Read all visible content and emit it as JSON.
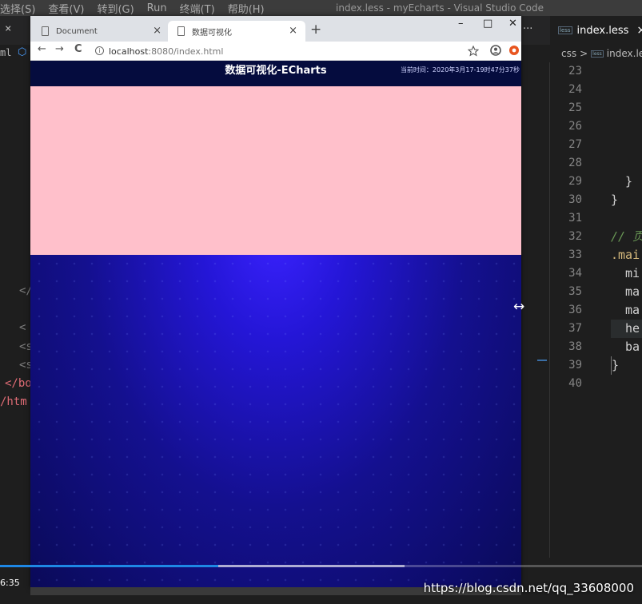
{
  "vscode": {
    "menu": [
      "选择(S)",
      "查看(V)",
      "转到(G)",
      "Run",
      "终端(T)",
      "帮助(H)"
    ],
    "window_title": "index.less - myEcharts - Visual Studio Code",
    "left_fragments": {
      "tab_close": "×",
      "bc_prefix": "ml",
      "line_a": "</",
      "line_b": "<",
      "line_c": "<s",
      "line_d": "<s",
      "line_e": "</bo",
      "line_f": "/htm"
    },
    "right_tab": {
      "badge": "less",
      "name": "index.less",
      "close": "×",
      "more": "···"
    },
    "breadcrumb": {
      "folder": "css",
      "sep": ">",
      "badge": "less",
      "file": "index.le"
    },
    "line_numbers": [
      "23",
      "24",
      "25",
      "26",
      "27",
      "28",
      "29",
      "30",
      "31",
      "32",
      "33",
      "34",
      "35",
      "36",
      "37",
      "38",
      "39",
      "40"
    ],
    "code_lines": [
      "",
      "",
      "",
      "",
      "",
      "",
      "}",
      "}",
      "",
      "// 页",
      ".mai",
      "mi",
      "ma",
      "ma",
      "he",
      "ba",
      "}",
      ""
    ]
  },
  "browser": {
    "tabs": [
      {
        "label": "Document",
        "close": "×"
      },
      {
        "label": "数据可视化",
        "close": "×"
      }
    ],
    "new_tab": "+",
    "window_controls": {
      "minimize": "–",
      "maximize": "□",
      "close": "✕"
    },
    "nav": {
      "back": "←",
      "forward": "→",
      "reload": "C"
    },
    "url": {
      "host": "localhost",
      "path": ":8080/index.html"
    }
  },
  "page": {
    "title": "数据可视化-ECharts",
    "time": "当前时间：2020年3月17-19时47分37秒"
  },
  "colors": {
    "pink_panel": "#ffc0cb",
    "page_bg": "#14108f",
    "progress": "#1e88e5"
  },
  "video": {
    "time": "6:35",
    "progress_percent": 34
  },
  "watermark": "https://blog.csdn.net/qq_33608000"
}
